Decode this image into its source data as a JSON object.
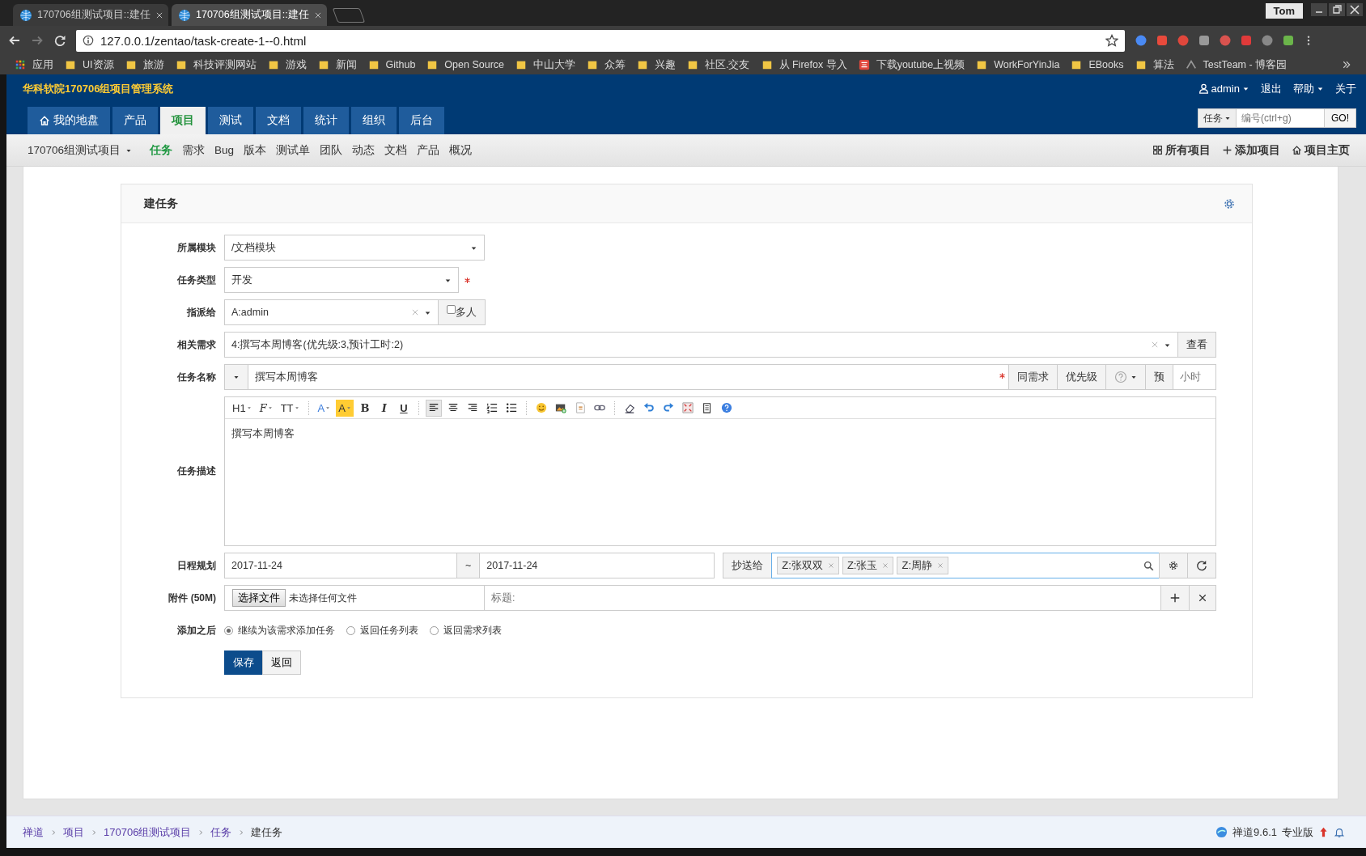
{
  "browser": {
    "tabs": [
      {
        "title": "170706组测试项目::建任",
        "selected": false
      },
      {
        "title": "170706组测试项目::建任",
        "selected": true
      }
    ],
    "profile": "Tom",
    "address": "127.0.0.1/zentao/task-create-1--0.html",
    "bookmarks": [
      {
        "kind": "apps",
        "label": "应用"
      },
      {
        "kind": "folder",
        "label": "UI资源"
      },
      {
        "kind": "folder",
        "label": "旅游"
      },
      {
        "kind": "folder",
        "label": "科技评测网站"
      },
      {
        "kind": "folder",
        "label": "游戏"
      },
      {
        "kind": "folder",
        "label": "新闻"
      },
      {
        "kind": "folder",
        "label": "Github"
      },
      {
        "kind": "folder",
        "label": "Open Source"
      },
      {
        "kind": "folder",
        "label": "中山大学"
      },
      {
        "kind": "folder",
        "label": "众筹"
      },
      {
        "kind": "folder",
        "label": "兴趣"
      },
      {
        "kind": "folder",
        "label": "社区.交友"
      },
      {
        "kind": "folder",
        "label": "从 Firefox 导入"
      },
      {
        "kind": "site",
        "label": "下载youtube上视频"
      },
      {
        "kind": "folder",
        "label": "WorkForYinJia"
      },
      {
        "kind": "folder",
        "label": "EBooks"
      },
      {
        "kind": "folder",
        "label": "算法"
      },
      {
        "kind": "logo",
        "label": "TestTeam - 博客园"
      }
    ]
  },
  "app": {
    "title": "华科软院170706组项目管理系统",
    "user": "admin",
    "links": [
      {
        "label": "退出",
        "caret": false
      },
      {
        "label": "帮助",
        "caret": true
      },
      {
        "label": "关于",
        "caret": false
      }
    ],
    "nav": [
      {
        "label": "我的地盘",
        "home": true,
        "selected": false
      },
      {
        "label": "产品",
        "home": false,
        "selected": false
      },
      {
        "label": "项目",
        "home": false,
        "selected": true
      },
      {
        "label": "测试",
        "home": false,
        "selected": false
      },
      {
        "label": "文档",
        "home": false,
        "selected": false
      },
      {
        "label": "统计",
        "home": false,
        "selected": false
      },
      {
        "label": "组织",
        "home": false,
        "selected": false
      },
      {
        "label": "后台",
        "home": false,
        "selected": false
      }
    ],
    "search": {
      "type": "任务",
      "placeholder": "编号(ctrl+g)",
      "button": "GO!"
    }
  },
  "subnav": {
    "project": "170706组测试项目",
    "items": [
      {
        "label": "任务",
        "selected": true
      },
      {
        "label": "需求",
        "selected": false
      },
      {
        "label": "Bug",
        "selected": false
      },
      {
        "label": "版本",
        "selected": false
      },
      {
        "label": "测试单",
        "selected": false
      },
      {
        "label": "团队",
        "selected": false
      },
      {
        "label": "动态",
        "selected": false
      },
      {
        "label": "文档",
        "selected": false
      },
      {
        "label": "产品",
        "selected": false
      },
      {
        "label": "概况",
        "selected": false
      }
    ],
    "actions": [
      {
        "kind": "grid",
        "label": "所有项目"
      },
      {
        "kind": "plus",
        "label": "添加项目"
      },
      {
        "kind": "home",
        "label": "项目主页"
      }
    ]
  },
  "form": {
    "title": "建任务",
    "module": {
      "label": "所属模块",
      "value": "/文档模块"
    },
    "type": {
      "label": "任务类型",
      "value": "开发",
      "required": true
    },
    "assign": {
      "label": "指派给",
      "value": "A:admin",
      "multi_label": "多人",
      "multi_checked": false
    },
    "story": {
      "label": "相关需求",
      "value": "4:撰写本周博客(优先级:3,预计工时:2)",
      "button": "查看"
    },
    "name": {
      "label": "任务名称",
      "value": "撰写本周博客",
      "required": true,
      "buttons": [
        "同需求",
        "优先级"
      ],
      "estimate_label": "预",
      "estimate_placeholder": "小时"
    },
    "desc": {
      "label": "任务描述",
      "value": "撰写本周博客",
      "toolbar": [
        {
          "kind": "heading",
          "text": "H1"
        },
        {
          "kind": "font",
          "text": "F"
        },
        {
          "kind": "size",
          "text": "TT"
        },
        {
          "kind": "sep"
        },
        {
          "kind": "forecolor",
          "text": "A"
        },
        {
          "kind": "backcolor",
          "text": "A"
        },
        {
          "kind": "bold",
          "text": "B"
        },
        {
          "kind": "italic",
          "text": "I"
        },
        {
          "kind": "underline",
          "text": "U"
        },
        {
          "kind": "sep"
        },
        {
          "kind": "align-left",
          "selected": true
        },
        {
          "kind": "align-center",
          "selected": false
        },
        {
          "kind": "align-right",
          "selected": false
        },
        {
          "kind": "ordered-list",
          "selected": false
        },
        {
          "kind": "bullet-list",
          "selected": false
        },
        {
          "kind": "sep"
        },
        {
          "kind": "emoticon"
        },
        {
          "kind": "image"
        },
        {
          "kind": "code"
        },
        {
          "kind": "link"
        },
        {
          "kind": "sep"
        },
        {
          "kind": "eraser"
        },
        {
          "kind": "undo"
        },
        {
          "kind": "redo"
        },
        {
          "kind": "fullscreen"
        },
        {
          "kind": "paste"
        },
        {
          "kind": "help"
        }
      ]
    },
    "schedule": {
      "label": "日程规划",
      "begin": "2017-11-24",
      "separator": "~",
      "end": "2017-11-24",
      "mailto_label": "抄送给",
      "mailto": [
        "Z:张双双",
        "Z:张玉",
        "Z:周静"
      ]
    },
    "files": {
      "label": "附件 (50M)",
      "button": "选择文件",
      "status": "未选择任何文件",
      "title_placeholder": "标题:"
    },
    "after": {
      "label": "添加之后",
      "options": [
        {
          "label": "继续为该需求添加任务",
          "selected": true
        },
        {
          "label": "返回任务列表",
          "selected": false
        },
        {
          "label": "返回需求列表",
          "selected": false
        }
      ]
    },
    "buttons": [
      "保存",
      "返回"
    ]
  },
  "footer": {
    "crumbs": [
      "禅道",
      "项目",
      "170706组测试项目",
      "任务",
      "建任务"
    ],
    "version": "禅道9.6.1",
    "edition": "专业版"
  }
}
